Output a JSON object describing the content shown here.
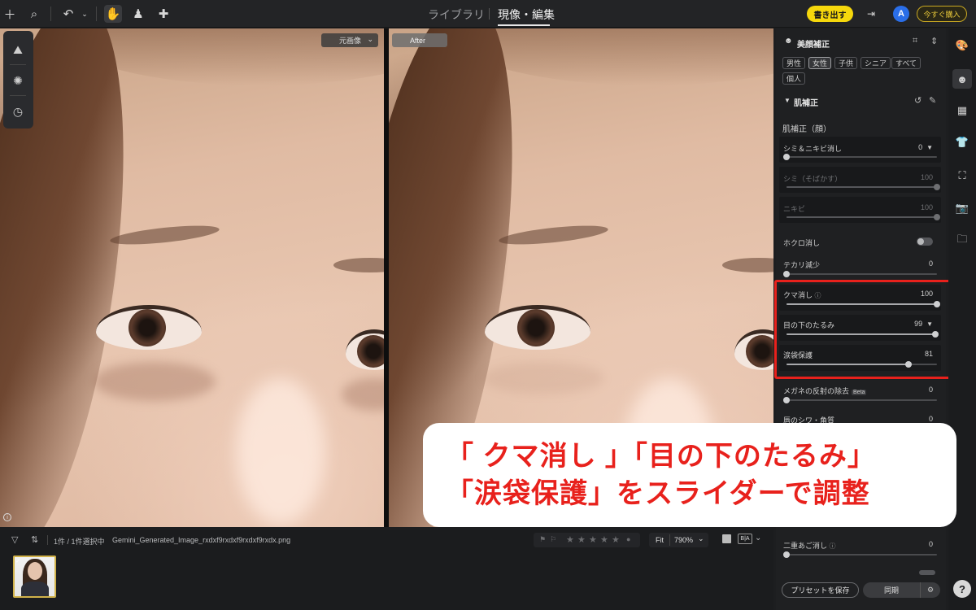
{
  "topbar": {
    "tab_library": "ライブラリ",
    "tab_develop": "現像・編集",
    "export_label": "書き出す",
    "avatar_letter": "A",
    "buy_label": "今すぐ購入"
  },
  "viewer": {
    "original_label": "元画像",
    "after_label": "After"
  },
  "filmstrip": {
    "selection_count": "1件 / 1件選択中",
    "filename": "Gemini_Generated_Image_rxdxf9rxdxf9rxdxf9rxdx.png",
    "fit_label": "Fit",
    "zoom": "790%",
    "rating": 0
  },
  "panel": {
    "title": "美顔補正",
    "presets": [
      "男性",
      "女性",
      "子供",
      "シニア",
      "すべて",
      "個人"
    ],
    "selected_preset": "女性",
    "section": "肌補正",
    "subsection": "肌補正（顔）",
    "sliders": [
      {
        "label": "シミ＆ニキビ消し",
        "value": "0",
        "dim": false,
        "dropdown": true
      },
      {
        "label": "シミ（そばかす）",
        "value": "100",
        "dim": true
      },
      {
        "label": "ニキビ",
        "value": "100",
        "dim": true
      },
      {
        "label": "ホクロ消し",
        "toggle": true
      },
      {
        "label": "テカリ減少",
        "value": "0"
      },
      {
        "label": "クマ消し",
        "value": "100",
        "help": true
      },
      {
        "label": "目の下のたるみ",
        "value": "99",
        "dropdown": true
      },
      {
        "label": "涙袋保護",
        "value": "81"
      },
      {
        "label": "メガネの反射の除去",
        "value": "0",
        "badge": "Beta"
      },
      {
        "label": "唇のシワ・角質",
        "value": "0"
      },
      {
        "label": "二重あご消し",
        "value": "0",
        "help": true
      }
    ],
    "save_preset_label": "プリセットを保存",
    "sync_label": "同期"
  },
  "annotation": {
    "line1": "「 クマ消し 」「目の下のたるみ」",
    "line2": "「涙袋保護」をスライダーで調整"
  },
  "colors": {
    "accent_yellow": "#f5d70c",
    "highlight_red": "#e8211c",
    "avatar_blue": "#2a6ee8"
  }
}
